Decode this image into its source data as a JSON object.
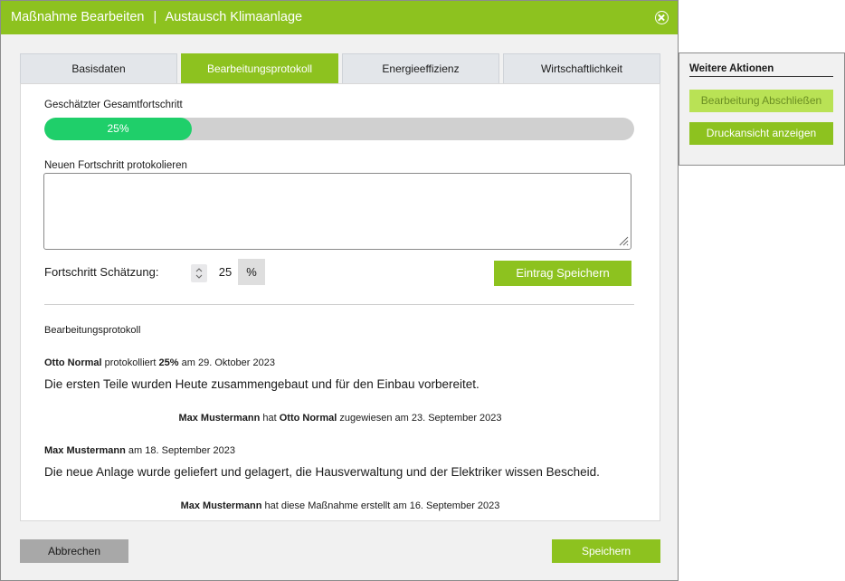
{
  "header": {
    "title": "Maßnahme Bearbeiten",
    "separator": "|",
    "subtitle": "Austausch Klimaanlage",
    "close_icon": "close-circle-icon"
  },
  "tabs": [
    {
      "label": "Basisdaten",
      "active": false
    },
    {
      "label": "Bearbeitungsprotokoll",
      "active": true
    },
    {
      "label": "Energieeffizienz",
      "active": false
    },
    {
      "label": "Wirtschaftlichkeit",
      "active": false
    }
  ],
  "progress": {
    "label": "Geschätzter Gesamtfortschritt",
    "value": 0.25,
    "value_text": "25%"
  },
  "new_entry": {
    "label": "Neuen Fortschritt protokolieren",
    "text": "",
    "estimate_label": "Fortschritt Schätzung:",
    "estimate_value": "25",
    "unit": "%",
    "save_label": "Eintrag Speichern"
  },
  "log": {
    "title": "Bearbeitungsprotokoll",
    "entry1": {
      "author": "Otto Normal",
      "verb": "protokolliert",
      "percent": "25%",
      "date_text": "am 29. Oktober 2023",
      "text": "Die ersten Teile wurden Heute zusammengebaut und für den Einbau vorbereitet."
    },
    "note1": {
      "actor": "Max Mustermann",
      "mid": "hat",
      "target": "Otto Normal",
      "rest": "zugewiesen am 23. September 2023"
    },
    "entry2": {
      "author": "Max Mustermann",
      "date_text": "am 18. September 2023",
      "text": "Die neue Anlage wurde geliefert und gelagert, die Hausverwaltung und der Elektriker wissen Bescheid."
    },
    "note2": {
      "actor": "Max Mustermann",
      "rest": "hat diese Maßnahme erstellt am 16. September 2023"
    }
  },
  "footer": {
    "cancel_label": "Abbrechen",
    "save_label": "Speichern"
  },
  "side_panel": {
    "title": "Weitere Aktionen",
    "complete_label": "Bearbeitung Abschließen",
    "print_label": "Druckansicht anzeigen"
  },
  "colors": {
    "brand_green": "#8dc21f",
    "progress_green": "#1fcf6a",
    "disabled_green": "#b9e255"
  }
}
